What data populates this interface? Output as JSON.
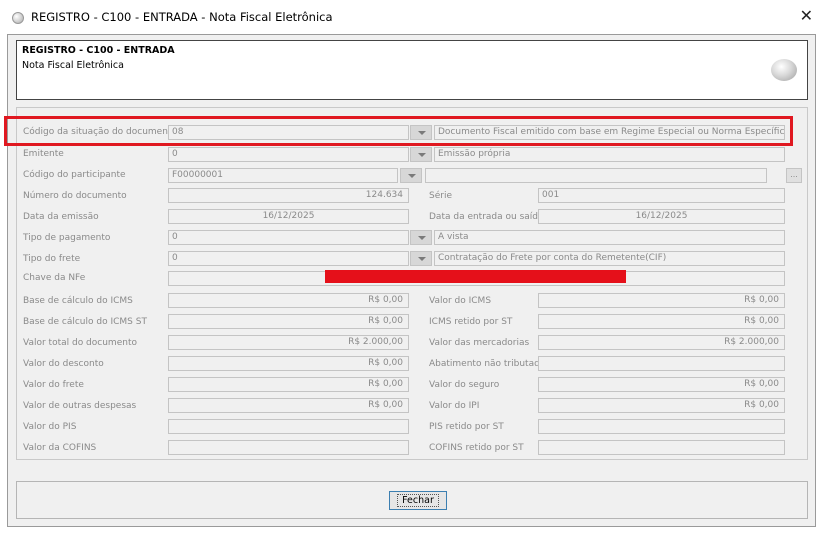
{
  "window": {
    "title": "REGISTRO - C100 - ENTRADA - Nota Fiscal Eletrônica",
    "close_glyph": "✕"
  },
  "header": {
    "title": "REGISTRO - C100 - ENTRADA",
    "subtitle": "Nota Fiscal Eletrônica",
    "logo_icon": "gray-sphere-icon"
  },
  "form": {
    "situacao": {
      "label": "Código da situação do documento",
      "code": "08",
      "description": "Documento Fiscal emitido com base em Regime Especial ou Norma Específica"
    },
    "emitente": {
      "label": "Emitente",
      "code": "0",
      "description": "Emissão própria"
    },
    "participante": {
      "label": "Código do participante",
      "code": "F00000001",
      "description": "",
      "ellipsis": "..."
    },
    "numero": {
      "label": "Número do documento",
      "value": "124.634"
    },
    "serie": {
      "label": "Série",
      "value": "001"
    },
    "data_emissao": {
      "label": "Data da emissão",
      "value": "16/12/2025"
    },
    "data_entrada": {
      "label": "Data da entrada ou saída",
      "value": "16/12/2025"
    },
    "pagamento": {
      "label": "Tipo de pagamento",
      "code": "0",
      "description": "A vista"
    },
    "frete": {
      "label": "Tipo do frete",
      "code": "0",
      "description": "Contratação do Frete por conta do Remetente(CIF)"
    },
    "chave_nfe": {
      "label": "Chave da NFe",
      "value": ""
    },
    "bc_icms": {
      "label": "Base de cálculo do ICMS",
      "value": "R$ 0,00"
    },
    "valor_icms": {
      "label": "Valor do ICMS",
      "value": "R$ 0,00"
    },
    "bc_icms_st": {
      "label": "Base de cálculo do ICMS ST",
      "value": "R$ 0,00"
    },
    "icms_retido_st": {
      "label": "ICMS retido por ST",
      "value": "R$ 0,00"
    },
    "valor_total": {
      "label": "Valor total do documento",
      "value": "R$ 2.000,00"
    },
    "valor_mercadorias": {
      "label": "Valor das mercadorias",
      "value": "R$ 2.000,00"
    },
    "valor_desconto": {
      "label": "Valor do desconto",
      "value": "R$ 0,00"
    },
    "abatimento": {
      "label": "Abatimento não tributado",
      "value": ""
    },
    "valor_frete": {
      "label": "Valor do frete",
      "value": "R$ 0,00"
    },
    "valor_seguro": {
      "label": "Valor do seguro",
      "value": "R$ 0,00"
    },
    "outras_despesas": {
      "label": "Valor de outras despesas",
      "value": "R$ 0,00"
    },
    "valor_ipi": {
      "label": "Valor do IPI",
      "value": "R$ 0,00"
    },
    "valor_pis": {
      "label": "Valor do PIS",
      "value": ""
    },
    "pis_retido": {
      "label": "PIS retido por ST",
      "value": ""
    },
    "valor_cofins": {
      "label": "Valor da COFINS",
      "value": ""
    },
    "cofins_retido": {
      "label": "COFINS retido por ST",
      "value": ""
    }
  },
  "footer": {
    "close_button": "Fechar"
  },
  "colors": {
    "highlight": "#e01820",
    "redaction": "#e5101a",
    "field_text": "#8a8a8a"
  }
}
